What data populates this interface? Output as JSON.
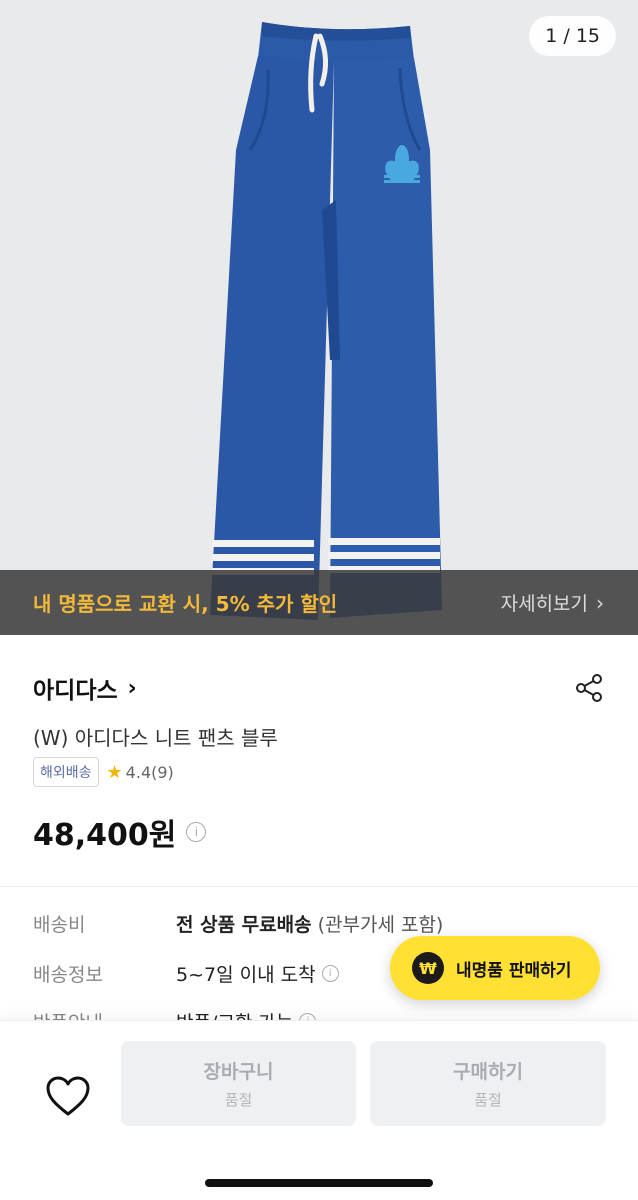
{
  "gallery": {
    "counter": "1 / 15",
    "promo_text": "내 명품으로 교환 시, 5% 추가 할인",
    "promo_link": "자세히보기",
    "product_color": "#2a58a6"
  },
  "product": {
    "brand": "아디다스",
    "name": "(W) 아디다스 니트 팬츠 블루",
    "badge": "해외배송",
    "rating": "4.4(9)",
    "price": "48,400원"
  },
  "shipping": {
    "fee_label": "배송비",
    "fee_value": "전 상품 무료배송",
    "fee_sub": "(관부가세 포함)",
    "info_label": "배송정보",
    "info_value": "5~7일 이내 도착",
    "return_label": "반품안내",
    "return_value": "반품/교환 가능"
  },
  "fab": {
    "label": "내명품 판매하기",
    "icon_glyph": "₩"
  },
  "bottom": {
    "cart_label": "장바구니",
    "cart_sub": "품절",
    "buy_label": "구매하기",
    "buy_sub": "품절"
  },
  "colors": {
    "accent_yellow": "#ffe033",
    "promo_orange": "#f3b93a",
    "disabled_bg": "#eef0f2"
  }
}
